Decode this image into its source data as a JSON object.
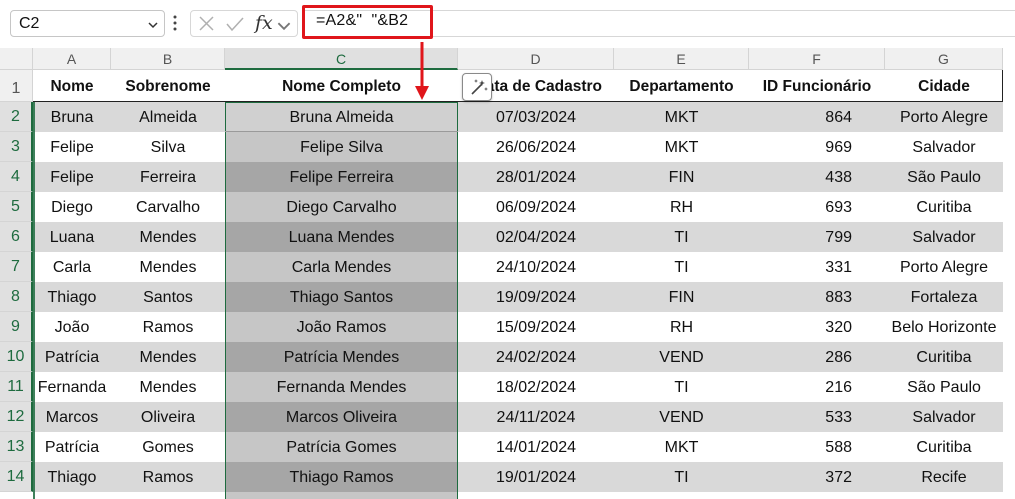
{
  "name_box": {
    "value": "C2"
  },
  "formula_bar": {
    "fx_label": "fx",
    "formula": "=A2&\"  \"&B2"
  },
  "columns": [
    "A",
    "B",
    "C",
    "D",
    "E",
    "F",
    "G"
  ],
  "row_numbers": [
    "1",
    "2",
    "3",
    "4",
    "5",
    "6",
    "7",
    "8",
    "9",
    "10",
    "11",
    "12",
    "13",
    "14"
  ],
  "table": {
    "headers": [
      "Nome",
      "Sobrenome",
      "Nome Completo",
      "Data de Cadastro",
      "Departamento",
      "ID Funcionário",
      "Cidade"
    ],
    "rows": [
      [
        "Bruna",
        "Almeida",
        "Bruna Almeida",
        "07/03/2024",
        "MKT",
        "864",
        "Porto Alegre"
      ],
      [
        "Felipe",
        "Silva",
        "Felipe Silva",
        "26/06/2024",
        "MKT",
        "969",
        "Salvador"
      ],
      [
        "Felipe",
        "Ferreira",
        "Felipe Ferreira",
        "28/01/2024",
        "FIN",
        "438",
        "São Paulo"
      ],
      [
        "Diego",
        "Carvalho",
        "Diego Carvalho",
        "06/09/2024",
        "RH",
        "693",
        "Curitiba"
      ],
      [
        "Luana",
        "Mendes",
        "Luana Mendes",
        "02/04/2024",
        "TI",
        "799",
        "Salvador"
      ],
      [
        "Carla",
        "Mendes",
        "Carla Mendes",
        "24/10/2024",
        "TI",
        "331",
        "Porto Alegre"
      ],
      [
        "Thiago",
        "Santos",
        "Thiago Santos",
        "19/09/2024",
        "FIN",
        "883",
        "Fortaleza"
      ],
      [
        "João",
        "Ramos",
        "João Ramos",
        "15/09/2024",
        "RH",
        "320",
        "Belo Horizonte"
      ],
      [
        "Patrícia",
        "Mendes",
        "Patrícia Mendes",
        "24/02/2024",
        "VEND",
        "286",
        "Curitiba"
      ],
      [
        "Fernanda",
        "Mendes",
        "Fernanda Mendes",
        "18/02/2024",
        "TI",
        "216",
        "São Paulo"
      ],
      [
        "Marcos",
        "Oliveira",
        "Marcos Oliveira",
        "24/11/2024",
        "VEND",
        "533",
        "Salvador"
      ],
      [
        "Patrícia",
        "Gomes",
        "Patrícia Gomes",
        "14/01/2024",
        "MKT",
        "588",
        "Curitiba"
      ],
      [
        "Thiago",
        "Ramos",
        "Thiago Ramos",
        "19/01/2024",
        "TI",
        "372",
        "Recife"
      ]
    ]
  },
  "colors": {
    "band_dark": "#d9d9d9",
    "band_light": "#ffffff",
    "selected_dark": "#a6a6a6",
    "selected_light": "#c6c6c6",
    "selection_border": "#1e6b3f",
    "highlight_red": "#e0161b"
  },
  "icons": {
    "name_box_dropdown": "chevron-down-icon",
    "cancel": "close-icon",
    "enter": "checkmark-icon",
    "flash_fill": "flash-fill-icon",
    "annotation": "red-arrow-icon"
  }
}
